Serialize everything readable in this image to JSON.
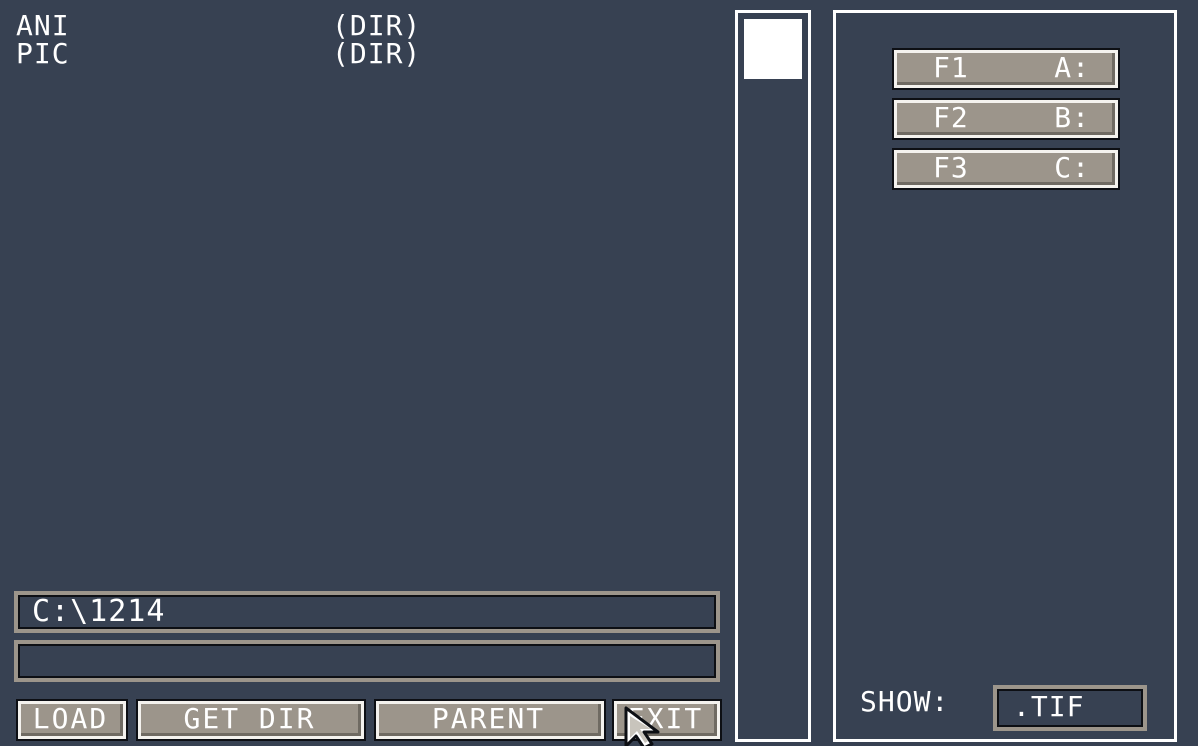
{
  "files": [
    {
      "name": "ANI",
      "type": "(DIR)"
    },
    {
      "name": "PIC",
      "type": "(DIR)"
    }
  ],
  "path": {
    "current": "C:\\1214",
    "filename": ""
  },
  "buttons": {
    "load": "LOAD",
    "get_dir": "GET DIR",
    "parent": "PARENT",
    "exit": "EXIT"
  },
  "drives": [
    {
      "key": "F1",
      "letter": "A:"
    },
    {
      "key": "F2",
      "letter": "B:"
    },
    {
      "key": "F3",
      "letter": "C:"
    }
  ],
  "filter": {
    "label": "SHOW:",
    "value": ".TIF"
  },
  "colors": {
    "background": "#374152",
    "button_face": "#9c958b",
    "text": "#ffffff"
  },
  "icons": {
    "cursor": "arrow-pointer-icon"
  }
}
